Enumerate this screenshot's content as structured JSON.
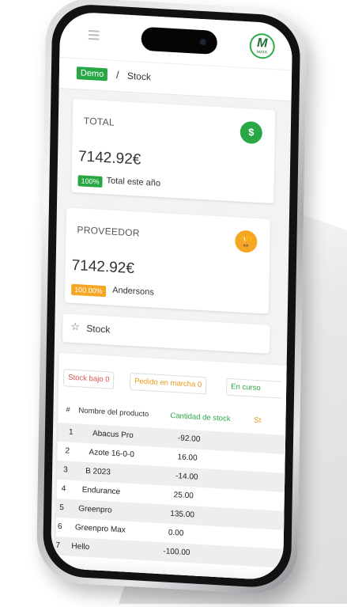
{
  "breadcrumb": {
    "demo": "Demo",
    "separator": "/",
    "current": "Stock"
  },
  "colors": {
    "green": "#27a844",
    "orange": "#f5a623",
    "red": "#d9534f",
    "green_text": "#27a844",
    "orange_text": "#e69a1b"
  },
  "cards": {
    "total": {
      "title": "TOTAL",
      "value": "7142.92€",
      "badge": "100%",
      "subtitle": "Total este año",
      "icon": "dollar-icon",
      "icon_glyph": "$"
    },
    "proveedor": {
      "title": "PROVEEDOR",
      "value": "7142.92€",
      "badge": "100.00%",
      "subtitle": "Andersons",
      "icon": "trophy-icon",
      "icon_glyph": "🏆"
    }
  },
  "section": {
    "star_glyph": "☆",
    "label": "Stock"
  },
  "chips": {
    "stock_bajo": "Stock bajo 0",
    "pedido": "Pedido en marcha 0",
    "en_curso": "En curso"
  },
  "table": {
    "headers": {
      "num": "#",
      "name": "Nombre del producto",
      "qty": "Cantidad de stock",
      "extra": "St"
    },
    "rows": [
      {
        "num": "1",
        "name": "Abacus Pro",
        "qty": "-92.00"
      },
      {
        "num": "2",
        "name": "Azote 16-0-0",
        "qty": "16.00"
      },
      {
        "num": "3",
        "name": "B 2023",
        "qty": "-14.00"
      },
      {
        "num": "4",
        "name": "Endurance",
        "qty": "25.00"
      },
      {
        "num": "5",
        "name": "Greenpro",
        "qty": "135.00"
      },
      {
        "num": "6",
        "name": "Greenpro Max",
        "qty": "0.00"
      },
      {
        "num": "7",
        "name": "Hello",
        "qty": "-100.00"
      }
    ]
  },
  "logo": {
    "letter": "M",
    "text": "MATA"
  }
}
